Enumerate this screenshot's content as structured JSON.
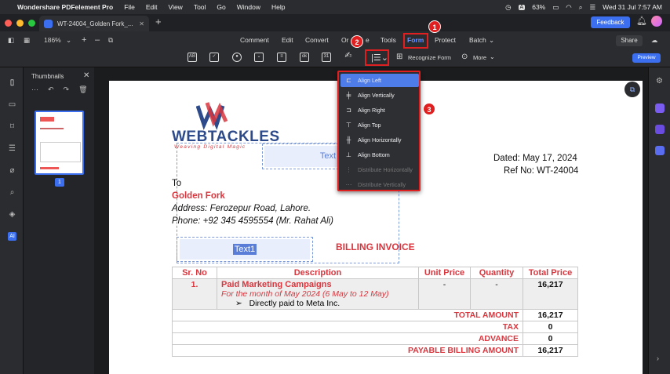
{
  "menubar": {
    "app": "Wondershare PDFelement Pro",
    "items": [
      "File",
      "Edit",
      "View",
      "Tool",
      "Go",
      "Window",
      "Help"
    ],
    "battery": "63%",
    "datetime": "Wed 31 Jul  7:57 AM"
  },
  "tab": {
    "title": "WT-24004_Golden Fork_...",
    "feedback": "Feedback"
  },
  "zoom": "186%",
  "nav": [
    "Comment",
    "Edit",
    "Convert",
    "Or",
    "e",
    "Tools",
    "Form",
    "Protect",
    "Batch"
  ],
  "share": "Share",
  "form_tools": {
    "recognize": "Recognize Form",
    "more": "More",
    "preview": "Preview"
  },
  "thumbnails": {
    "title": "Thumbnails",
    "page": "1"
  },
  "dropdown": {
    "items": [
      {
        "label": "Align Left"
      },
      {
        "label": "Align Vertically"
      },
      {
        "label": "Align Right"
      },
      {
        "label": "Align Top"
      },
      {
        "label": "Align Horizontally"
      },
      {
        "label": "Align Bottom"
      },
      {
        "label": "Distribute Horizontally"
      },
      {
        "label": "Distribute Vertically"
      }
    ]
  },
  "badges": [
    "1",
    "2",
    "3"
  ],
  "doc": {
    "logo": "WEBTACKLES",
    "tagline": "Weaving Digital Magic",
    "dated": "Dated: May 17, 2024",
    "ref": "Ref No: WT-24004",
    "to": "To",
    "client": "Golden Fork",
    "address": "Address: Ferozepur Road, Lahore.",
    "phone": "Phone: +92 345 4595554 (Mr. Rahat Ali)",
    "field_top": "Text",
    "field_bottom": "Text1",
    "invoice_title": "BILLING INVOICE",
    "table": {
      "headers": [
        "Sr. No",
        "Description",
        "Unit Price",
        "Quantity",
        "Total Price"
      ],
      "row": {
        "sr": "1.",
        "desc": "Paid Marketing Campaigns",
        "sub": "For the month of May 2024 (6 May to 12 May)",
        "bullet": "Directly paid to Meta Inc.",
        "unit": "-",
        "qty": "-",
        "total": "16,217"
      },
      "totals": [
        {
          "label": "TOTAL AMOUNT",
          "value": "16,217"
        },
        {
          "label": "TAX",
          "value": "0"
        },
        {
          "label": "ADVANCE",
          "value": "0"
        },
        {
          "label": "PAYABLE BILLING AMOUNT",
          "value": "16,217"
        }
      ]
    }
  },
  "colors": {
    "accent": "#3b6ff0",
    "highlight": "#e02020",
    "brand_red": "#d9363e"
  }
}
